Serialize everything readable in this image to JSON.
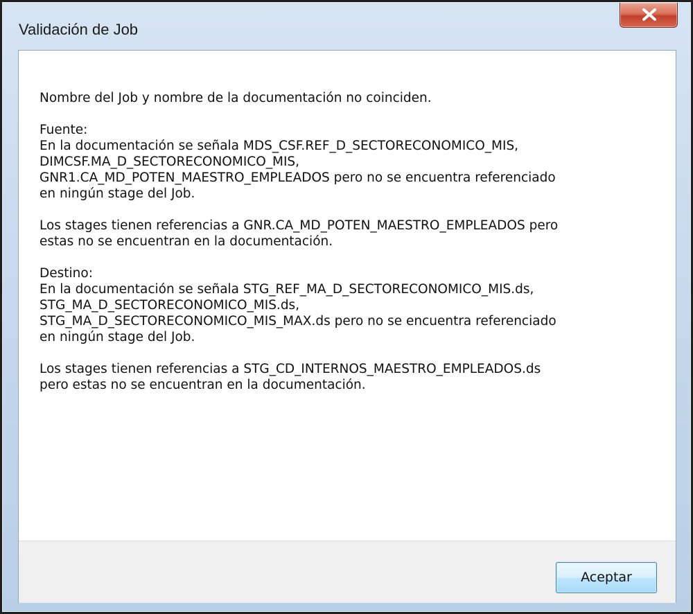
{
  "window": {
    "title": "Validación de Job",
    "close_icon": "close-x-icon"
  },
  "message": {
    "intro": "Nombre del Job y nombre de la documentación no coinciden.",
    "fuente": {
      "heading": "Fuente:",
      "lines": [
        "En la documentación se señala MDS_CSF.REF_D_SECTORECONOMICO_MIS,",
        "DIMCSF.MA_D_SECTORECONOMICO_MIS,",
        "GNR1.CA_MD_POTEN_MAESTRO_EMPLEADOS pero no se encuentra referenciado",
        "en ningún stage del Job."
      ],
      "stages_lines": [
        "Los stages tienen referencias a GNR.CA_MD_POTEN_MAESTRO_EMPLEADOS pero",
        "estas no se encuentran en la documentación."
      ]
    },
    "destino": {
      "heading": "Destino:",
      "lines": [
        "En la documentación se señala STG_REF_MA_D_SECTORECONOMICO_MIS.ds,",
        "STG_MA_D_SECTORECONOMICO_MIS.ds,",
        "STG_MA_D_SECTORECONOMICO_MIS_MAX.ds pero no se encuentra referenciado",
        "en ningún stage del Job."
      ],
      "stages_lines": [
        "Los stages tienen referencias a STG_CD_INTERNOS_MAESTRO_EMPLEADOS.ds",
        "pero estas no se encuentran en la documentación."
      ]
    }
  },
  "buttons": {
    "accept_label": "Aceptar"
  }
}
